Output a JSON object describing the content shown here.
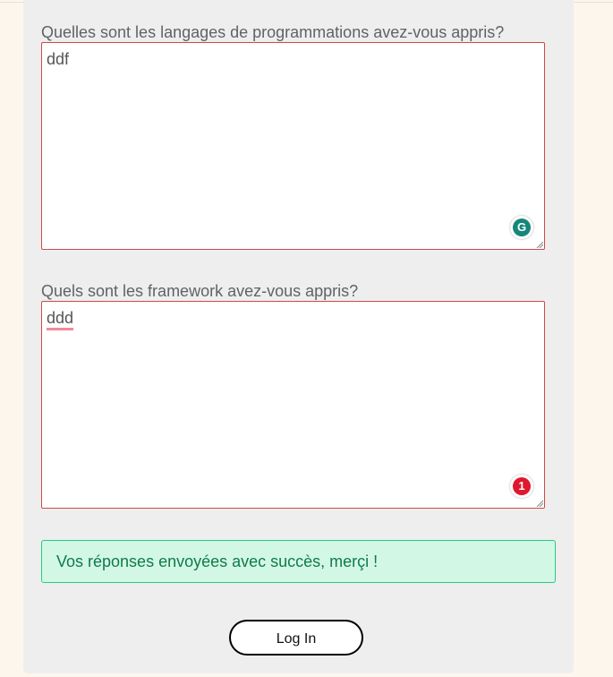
{
  "form": {
    "question_languages": "Quelles sont les langages de programmations avez-vous appris?",
    "answer_languages": "ddf",
    "question_frameworks": "Quels sont les framework avez-vous appris?",
    "answer_frameworks": "ddd",
    "grammarly_alert_count": "1",
    "success_message": "Vos réponses envoyées avec succès, merçi !",
    "login_button_label": "Log In"
  },
  "colors": {
    "page_background": "#fdf6ec",
    "panel_background": "#eeeeee",
    "field_border": "#d04848",
    "success_background": "#d2f8e5",
    "success_border": "#28c98a",
    "success_text": "#107a4a",
    "grammarly_green": "#15877a",
    "grammarly_red": "#e0182d"
  },
  "icons": {
    "grammarly_logo": "grammarly-icon",
    "grammarly_alert": "grammarly-alert-icon",
    "resize": "resize-handle-icon"
  }
}
